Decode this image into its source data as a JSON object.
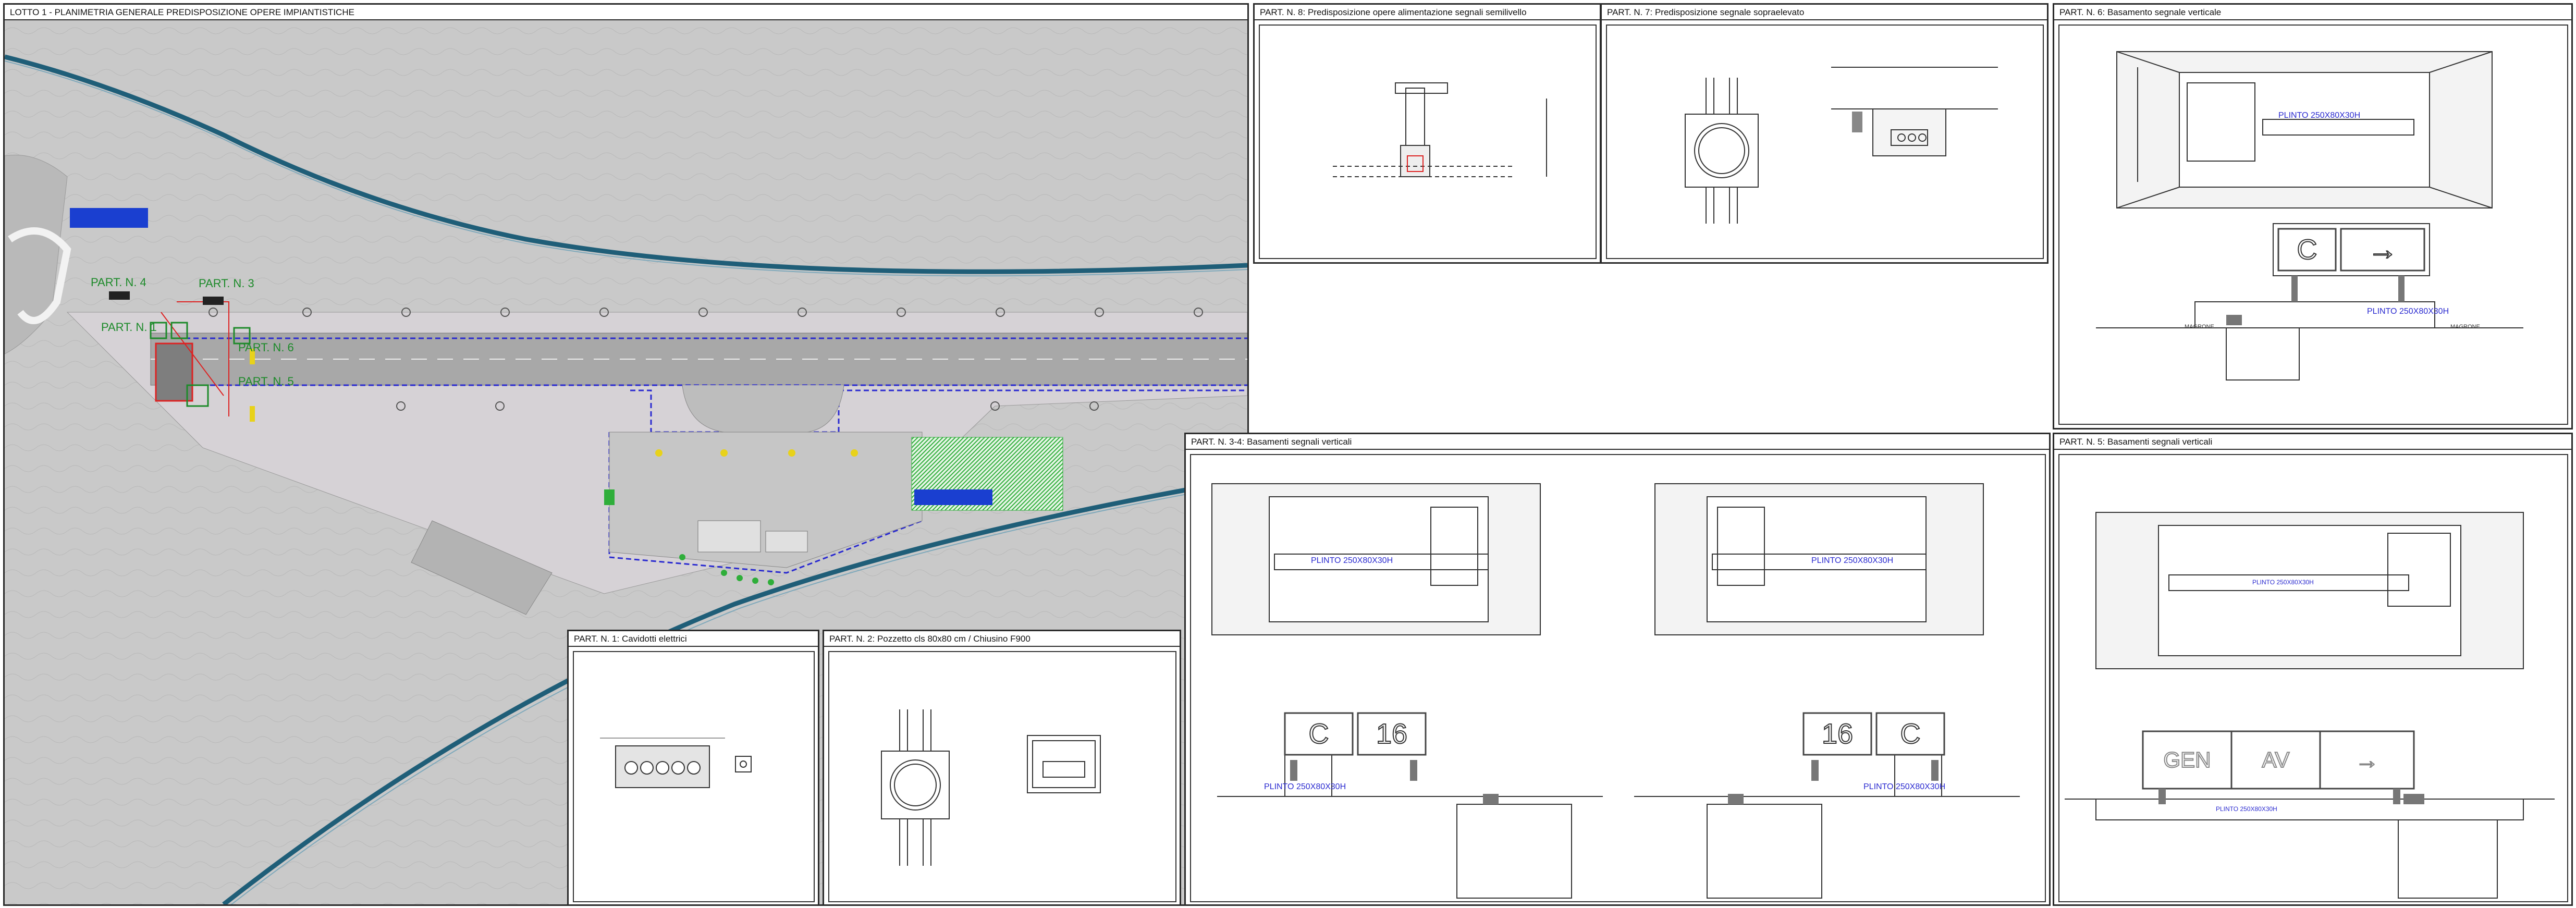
{
  "panels": {
    "main_plan": "LOTTO 1 - PLANIMETRIA GENERALE PREDISPOSIZIONE OPERE IMPIANTISTICHE",
    "part8": "PART. N. 8: Predisposizione opere alimentazione segnali semilivello",
    "part7": "PART. N. 7: Predisposizione segnale sopraelevato",
    "part6": "PART. N. 6: Basamento segnale verticale",
    "part34": "PART. N. 3-4: Basamenti segnali verticali",
    "part5": "PART. N. 5: Basamenti segnali verticali",
    "part1": "PART. N. 1: Cavidotti elettrici",
    "part2": "PART. N. 2: Pozzetto cls 80x80 cm / Chiusino F900"
  },
  "plan_labels": {
    "part4": "PART. N. 4",
    "part3": "PART. N. 3",
    "part1": "PART. N. 1",
    "part6": "PART. N. 6",
    "part5": "PART. N. 5"
  },
  "signs": {
    "plinto": "PLINTO 250X80X30H",
    "c": "C",
    "n16": "16",
    "gen": "GEN",
    "av": "AV",
    "arrow": "→",
    "magrone": "MAGRONE"
  },
  "colors": {
    "terrain": "#c9c9c9",
    "runway": "#a8a8a8",
    "apron": "#d6d2d6",
    "river": "#1f5e78",
    "blue_line": "#2a2ad0",
    "green": "#1d8a2a",
    "red": "#d22",
    "grass_hatch": "#2fae3a",
    "solar_blue": "#1a3fd0"
  }
}
